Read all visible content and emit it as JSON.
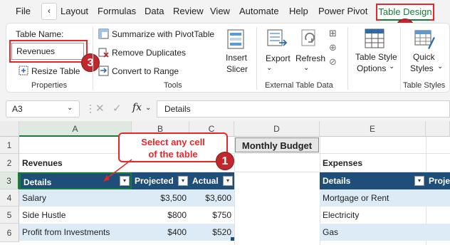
{
  "menu": {
    "file": "File",
    "arrow": "‹",
    "layout": "Layout",
    "formulas": "Formulas",
    "data": "Data",
    "review": "Review",
    "view": "View",
    "automate": "Automate",
    "help": "Help",
    "power_pivot": "Power Pivot",
    "table_design": "Table Design"
  },
  "ribbon": {
    "table_name_label": "Table Name:",
    "table_name_value": "Revenues",
    "resize_table": "Resize Table",
    "properties_label": "Properties",
    "summarize": "Summarize with PivotTable",
    "remove_duplicates": "Remove Duplicates",
    "convert_to_range": "Convert to Range",
    "insert_slicer_1": "Insert",
    "insert_slicer_2": "Slicer",
    "tools_label": "Tools",
    "export": "Export",
    "refresh": "Refresh",
    "external_label": "External Table Data",
    "style_options_1": "Table Style",
    "style_options_2": "Options",
    "quick_styles_1": "Quick",
    "quick_styles_2": "Styles",
    "table_styles_label": "Table Styles"
  },
  "formula_bar": {
    "name_box": "A3",
    "fx": "fx",
    "content": "Details"
  },
  "columns": [
    "A",
    "B",
    "C",
    "D",
    "E"
  ],
  "rows": [
    "1",
    "2",
    "3",
    "4",
    "5",
    "6"
  ],
  "sheet": {
    "d1": "Monthly Budget",
    "a2": "Revenues",
    "e2": "Expenses",
    "revenues_headers": [
      "Details",
      "Projected",
      "Actual"
    ],
    "revenues_rows": [
      [
        "Salary",
        "$3,500",
        "$3,600"
      ],
      [
        "Side Hustle",
        "$800",
        "$750"
      ],
      [
        "Profit from Investments",
        "$400",
        "$520"
      ]
    ],
    "expenses_headers": [
      "Details",
      "Proje"
    ],
    "expenses_rows": [
      "Mortgage or Rent",
      "Electricity",
      "Gas"
    ]
  },
  "annotations": {
    "callout_line1": "Select any cell",
    "callout_line2": "of the table",
    "badge1": "1",
    "badge2": "2",
    "badge3": "3",
    "highlight_color": "#e8262a"
  }
}
